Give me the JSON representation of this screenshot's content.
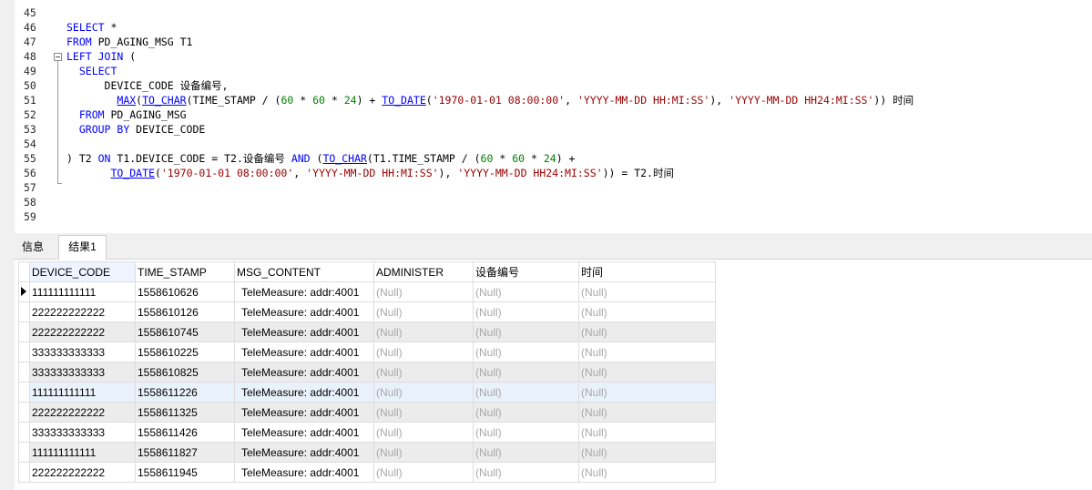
{
  "editor": {
    "lines": [
      {
        "n": "45",
        "html": ""
      },
      {
        "n": "46",
        "html": "<span class='kw'>SELECT</span> *"
      },
      {
        "n": "47",
        "html": "<span class='kw'>FROM</span> PD_AGING_MSG T1"
      },
      {
        "n": "48",
        "html": "<span class='kw'>LEFT JOIN</span> ("
      },
      {
        "n": "49",
        "html": "  <span class='kw'>SELECT</span>"
      },
      {
        "n": "50",
        "html": "      DEVICE_CODE 设备编号,"
      },
      {
        "n": "51",
        "html": "        <span class='fn'>MAX</span>(<span class='fn'>TO_CHAR</span>(TIME_STAMP / (<span class='num'>60</span> * <span class='num'>60</span> * <span class='num'>24</span>) + <span class='fn'>TO_DATE</span>(<span class='str'>'1970-01-01 08:00:00'</span>, <span class='str'>'YYYY-MM-DD HH:MI:SS'</span>), <span class='str'>'YYYY-MM-DD HH24:MI:SS'</span>)) 时间"
      },
      {
        "n": "52",
        "html": "  <span class='kw'>FROM</span> PD_AGING_MSG"
      },
      {
        "n": "53",
        "html": "  <span class='kw'>GROUP BY</span> DEVICE_CODE"
      },
      {
        "n": "54",
        "html": ""
      },
      {
        "n": "55",
        "html": ") T2 <span class='kw'>ON</span> T1.DEVICE_CODE = T2.设备编号 <span class='kw'>AND</span> (<span class='fn'>TO_CHAR</span>(T1.TIME_STAMP / (<span class='num'>60</span> * <span class='num'>60</span> * <span class='num'>24</span>) +"
      },
      {
        "n": "56",
        "html": "       <span class='fn'>TO_DATE</span>(<span class='str'>'1970-01-01 08:00:00'</span>, <span class='str'>'YYYY-MM-DD HH:MI:SS'</span>), <span class='str'>'YYYY-MM-DD HH24:MI:SS'</span>)) = T2.时间"
      },
      {
        "n": "57",
        "html": ""
      },
      {
        "n": "58",
        "html": ""
      },
      {
        "n": "59",
        "html": ""
      }
    ]
  },
  "tabs": {
    "info": "信息",
    "result": "结果1"
  },
  "grid": {
    "columns": [
      "DEVICE_CODE",
      "TIME_STAMP",
      "MSG_CONTENT",
      "ADMINISTER",
      "设备编号",
      "时间"
    ],
    "rows": [
      [
        "111111111111",
        "1558610626",
        "TeleMeasure: addr:4001",
        "(Null)",
        "(Null)",
        "(Null)"
      ],
      [
        "222222222222",
        "1558610126",
        "TeleMeasure: addr:4001",
        "(Null)",
        "(Null)",
        "(Null)"
      ],
      [
        "222222222222",
        "1558610745",
        "TeleMeasure: addr:4001",
        "(Null)",
        "(Null)",
        "(Null)"
      ],
      [
        "333333333333",
        "1558610225",
        "TeleMeasure: addr:4001",
        "(Null)",
        "(Null)",
        "(Null)"
      ],
      [
        "333333333333",
        "1558610825",
        "TeleMeasure: addr:4001",
        "(Null)",
        "(Null)",
        "(Null)"
      ],
      [
        "111111111111",
        "1558611226",
        "TeleMeasure: addr:4001",
        "(Null)",
        "(Null)",
        "(Null)"
      ],
      [
        "222222222222",
        "1558611325",
        "TeleMeasure: addr:4001",
        "(Null)",
        "(Null)",
        "(Null)"
      ],
      [
        "333333333333",
        "1558611426",
        "TeleMeasure: addr:4001",
        "(Null)",
        "(Null)",
        "(Null)"
      ],
      [
        "111111111111",
        "1558611827",
        "TeleMeasure: addr:4001",
        "(Null)",
        "(Null)",
        "(Null)"
      ],
      [
        "222222222222",
        "1558611945",
        "TeleMeasure: addr:4001",
        "(Null)",
        "(Null)",
        "(Null)"
      ]
    ]
  }
}
